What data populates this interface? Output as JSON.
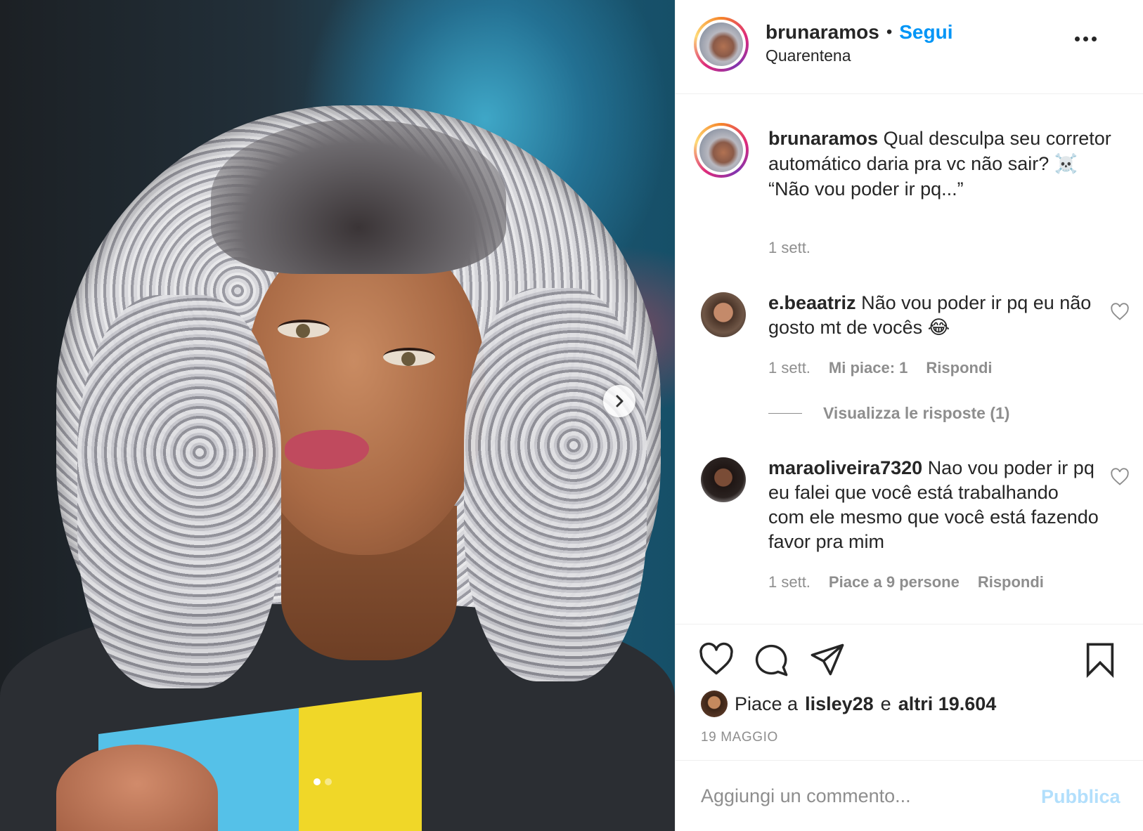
{
  "post": {
    "username": "brunaramos",
    "separator": "•",
    "follow_label": "Segui",
    "location": "Quarentena"
  },
  "caption": {
    "username": "brunaramos",
    "text_line1": "Qual desculpa seu corretor automático daria pra vc não sair? ☠️",
    "text_line2": "“Não vou poder ir pq...”",
    "time": "1 sett."
  },
  "comments": [
    {
      "username": "e.beaatriz",
      "text": "Não vou poder ir pq eu não gosto mt de vocês 😂",
      "time": "1 sett.",
      "likes": "Mi piace: 1",
      "reply_label": "Rispondi",
      "view_replies": "Visualizza le risposte (1)"
    },
    {
      "username": "maraoliveira7320",
      "text": "Nao vou poder ir pq eu falei que você está trabalhando com ele mesmo que você está fazendo favor pra mim",
      "time": "1 sett.",
      "likes": "Piace a 9 persone",
      "reply_label": "Rispondi"
    }
  ],
  "likes_summary": {
    "prefix": "Piace a",
    "user": "lisley28",
    "conj": "e",
    "others": "altri 19.604"
  },
  "date": "19 MAGGIO",
  "comment_box": {
    "placeholder": "Aggiungi un commento...",
    "publish_label": "Pubblica"
  },
  "carousel": {
    "current": 1,
    "total": 2
  },
  "colors": {
    "accent": "#0095f6",
    "publish_disabled": "#b2dffc",
    "muted": "#8e8e8e"
  },
  "icons": [
    "chevron-right-icon",
    "more-options-icon",
    "heart-icon",
    "comment-icon",
    "share-icon",
    "bookmark-icon"
  ]
}
